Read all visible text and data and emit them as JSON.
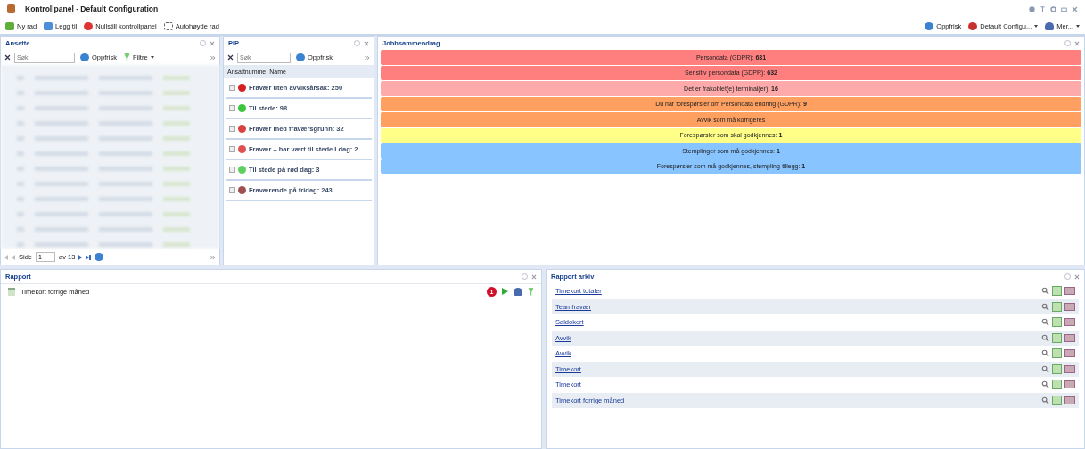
{
  "window": {
    "title": "Kontrollpanel - Default Configuration"
  },
  "toolbar": {
    "left": [
      "Ny rad",
      "Legg til",
      "Nullstill kontrollpanel",
      "Autohøyde rad"
    ],
    "right": [
      "Oppfrisk",
      "Default Configu...",
      "Mer..."
    ]
  },
  "ansatte": {
    "title": "Ansatte",
    "search": {
      "placeholder": "Søk"
    },
    "refresh": "Oppfrisk",
    "filter": "Filtre",
    "pager": {
      "page_label": "Side",
      "page": "1",
      "of": "av 13"
    }
  },
  "pip": {
    "title": "PIP",
    "search": {
      "placeholder": "Søk"
    },
    "refresh": "Oppfrisk",
    "columns": [
      "Ansattnumme",
      "Name"
    ],
    "groups": [
      {
        "label": "Fravær uten avviksårsak: 250",
        "color": "#d42020"
      },
      {
        "label": "Til stede: 98",
        "color": "#3cc43c"
      },
      {
        "label": "Fravær med fraværsgrunn: 32",
        "color": "#d94040"
      },
      {
        "label": "Fravær – har vært til stede I dag: 2",
        "color": "#e05050"
      },
      {
        "label": "Til stede på rød dag: 3",
        "color": "#5fcf5f"
      },
      {
        "label": "Fraværende på fridag: 243",
        "color": "#a05050"
      }
    ]
  },
  "summary": {
    "title": "Jobbsammendrag",
    "rows": [
      {
        "text": "Persondata (GDPR): **631**",
        "color": "#ff7f7f"
      },
      {
        "text": "Sensitiv persondata (GDPR): **632**",
        "color": "#ff7f7f"
      },
      {
        "text": "Det er frakoblet(e) terminal(er): **16**",
        "color": "#ffaaaa"
      },
      {
        "text": "Du har forespørsler om Persondata endring (GDPR): **9**",
        "color": "#ffa060"
      },
      {
        "text": "Avvik som må korrigeres",
        "color": "#ffa060"
      },
      {
        "text": "Forespørsler som skal godkjennes: **1**",
        "color": "#ffff88"
      },
      {
        "text": "Stemplinger som må godkjennes: **1**",
        "color": "#88c4ff"
      },
      {
        "text": "Forespørsler som må godkjennes, stempling-tillegg: **1**",
        "color": "#88c4ff"
      }
    ]
  },
  "rapport": {
    "title": "Rapport",
    "items": [
      {
        "label": "Timekort forrige måned",
        "badge": "1"
      }
    ]
  },
  "archive": {
    "title": "Rapport arkiv",
    "items": [
      "Timekort totaler",
      "Teamfravær",
      "Saldokort",
      "Avvik",
      "Avvik",
      "Timekort",
      "Timekort",
      "Timekort forrige måned"
    ]
  }
}
